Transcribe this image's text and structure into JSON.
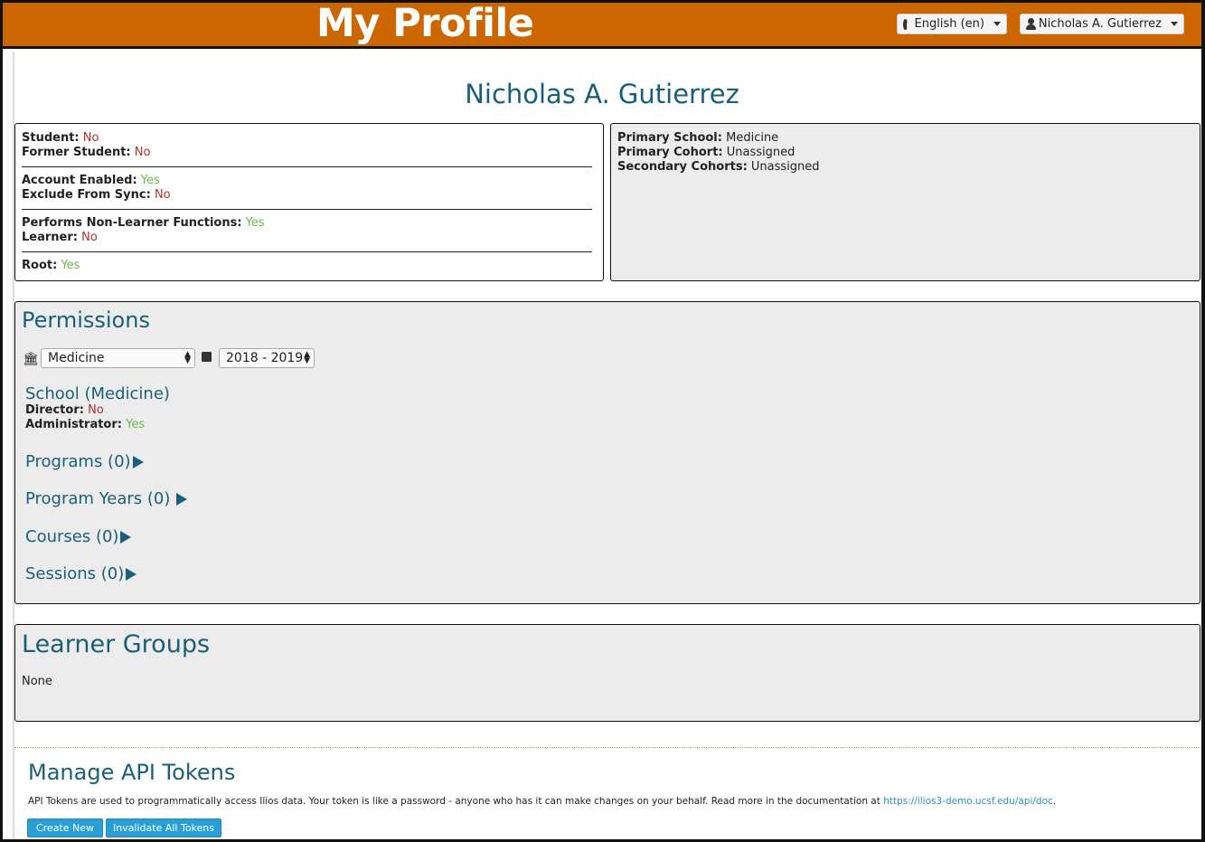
{
  "header": {
    "title": "My Profile",
    "language_label": "English (en)",
    "user_menu_label": "Nicholas A. Gutierrez"
  },
  "profile": {
    "name": "Nicholas A. Gutierrez",
    "left_box": {
      "student": {
        "label": "Student:",
        "value": "No"
      },
      "former_student": {
        "label": "Former Student:",
        "value": "No"
      },
      "account_enabled": {
        "label": "Account Enabled:",
        "value": "Yes"
      },
      "exclude_sync": {
        "label": "Exclude From Sync:",
        "value": "No"
      },
      "non_learner": {
        "label": "Performs Non-Learner Functions:",
        "value": "Yes"
      },
      "learner": {
        "label": "Learner:",
        "value": "No"
      },
      "root": {
        "label": "Root:",
        "value": "Yes"
      }
    },
    "right_box": {
      "primary_school": {
        "label": "Primary School:",
        "value": "Medicine"
      },
      "primary_cohort": {
        "label": "Primary Cohort:",
        "value": "Unassigned"
      },
      "secondary_cohorts": {
        "label": "Secondary Cohorts:",
        "value": "Unassigned"
      }
    }
  },
  "permissions": {
    "title": "Permissions",
    "school_select": "Medicine",
    "year_select": "2018 - 2019",
    "school_heading": "School (Medicine)",
    "director": {
      "label": "Director:",
      "value": "No"
    },
    "administrator": {
      "label": "Administrator:",
      "value": "Yes"
    },
    "sections": [
      "Programs (0)",
      "Program Years (0)",
      "Courses (0)",
      "Sessions (0)"
    ]
  },
  "learner_groups": {
    "title": "Learner Groups",
    "value": "None"
  },
  "api_tokens": {
    "title": "Manage API Tokens",
    "description": "API Tokens are used to programmatically access Ilios data. Your token is like a password - anyone who has it can make changes on your behalf. Read more in the documentation at ",
    "link": "https://ilios3-demo.ucsf.edu/api/doc",
    "after_link": ".",
    "create_button": "Create New",
    "invalidate_button": "Invalidate All Tokens"
  }
}
